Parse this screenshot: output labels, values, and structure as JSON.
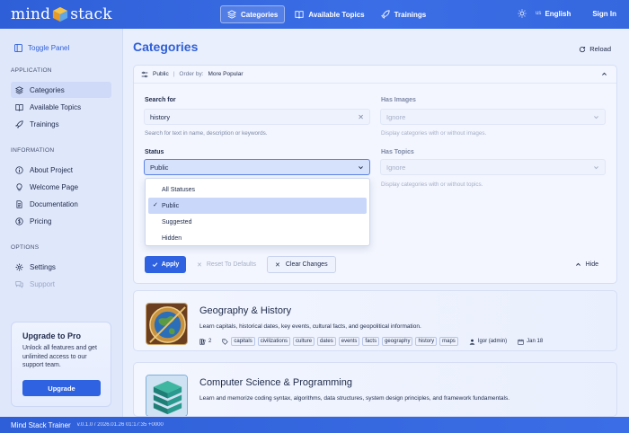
{
  "app": {
    "logo_left": "mind",
    "logo_right": "stack",
    "footer_name": "Mind Stack Trainer",
    "footer_version": "v.0.1.0 / 2026.01.26 01:17:35 +0000"
  },
  "topnav": {
    "items": [
      {
        "label": "Categories",
        "icon": "layers-icon",
        "active": true
      },
      {
        "label": "Available Topics",
        "icon": "book-icon",
        "active": false
      },
      {
        "label": "Trainings",
        "icon": "rocket-icon",
        "active": false
      }
    ],
    "lang_code": "us",
    "lang_label": "English",
    "signin": "Sign In"
  },
  "sidebar": {
    "toggle": "Toggle Panel",
    "sections": [
      {
        "label": "APPLICATION",
        "items": [
          {
            "label": "Categories",
            "icon": "layers-icon",
            "active": true
          },
          {
            "label": "Available Topics",
            "icon": "book-icon"
          },
          {
            "label": "Trainings",
            "icon": "rocket-icon"
          }
        ]
      },
      {
        "label": "INFORMATION",
        "items": [
          {
            "label": "About Project",
            "icon": "info-icon"
          },
          {
            "label": "Welcome Page",
            "icon": "bulb-icon"
          },
          {
            "label": "Documentation",
            "icon": "doc-icon"
          },
          {
            "label": "Pricing",
            "icon": "dollar-icon"
          }
        ]
      },
      {
        "label": "OPTIONS",
        "items": [
          {
            "label": "Settings",
            "icon": "gear-icon"
          },
          {
            "label": "Support",
            "icon": "chat-icon",
            "disabled": true
          }
        ]
      }
    ],
    "upgrade": {
      "title": "Upgrade to Pro",
      "text": "Unlock all features and get unlimited access to our support team.",
      "button": "Upgrade"
    }
  },
  "main": {
    "title": "Categories",
    "reload": "Reload",
    "filter": {
      "summary_status": "Public",
      "summary_order_label": "Order by:",
      "summary_order_value": "More Popular",
      "search_label": "Search for",
      "search_value": "history",
      "search_hint": "Search for text in name, description or keywords.",
      "status_label": "Status",
      "status_value": "Public",
      "status_options": [
        "All Statuses",
        "Public",
        "Suggested",
        "Hidden"
      ],
      "status_selected_index": 1,
      "has_images_label": "Has Images",
      "has_images_value": "Ignore",
      "has_images_hint": "Display categories with or without images.",
      "has_topics_label": "Has Topics",
      "has_topics_value": "Ignore",
      "has_topics_hint": "Display categories with or without topics.",
      "apply": "Apply",
      "reset": "Reset To Defaults",
      "clear": "Clear Changes",
      "hide": "Hide"
    },
    "cards": [
      {
        "title": "Geography & History",
        "description": "Learn capitals, historical dates, key events, cultural facts, and geopolitical information.",
        "topics_count": "2",
        "tags": [
          "capitals",
          "civilizations",
          "culture",
          "dates",
          "events",
          "facts",
          "geography",
          "history",
          "maps"
        ],
        "author": "Igor (admin)",
        "date": "Jan 18"
      },
      {
        "title": "Computer Science & Programming",
        "description": "Learn and memorize coding syntax, algorithms, data structures, system design principles, and framework fundamentals."
      }
    ]
  }
}
